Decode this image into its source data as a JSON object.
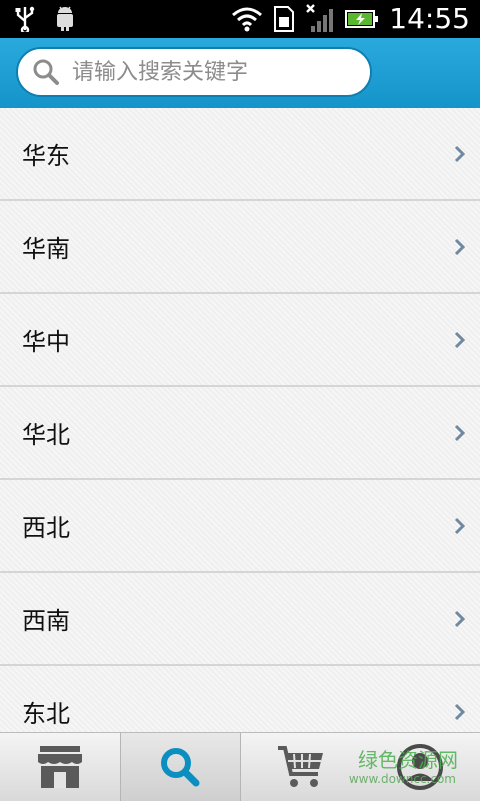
{
  "status_bar": {
    "time": "14:55",
    "icons": [
      "usb-icon",
      "android-debug-icon",
      "wifi-icon",
      "sim-icon",
      "signal-icon",
      "battery-charging-icon"
    ]
  },
  "search": {
    "placeholder": "请输入搜索关键字",
    "value": ""
  },
  "regions": [
    {
      "label": "华东"
    },
    {
      "label": "华南"
    },
    {
      "label": "华中"
    },
    {
      "label": "华北"
    },
    {
      "label": "西北"
    },
    {
      "label": "西南"
    },
    {
      "label": "东北"
    }
  ],
  "tabs": [
    {
      "name": "store-tab",
      "icon": "store-icon",
      "active": false
    },
    {
      "name": "search-tab",
      "icon": "search-icon",
      "active": true
    },
    {
      "name": "cart-tab",
      "icon": "cart-icon",
      "active": false
    },
    {
      "name": "profile-tab",
      "icon": "user-icon",
      "active": false
    }
  ],
  "watermark": {
    "text": "绿色资源网",
    "sub": "www.downcc.com"
  },
  "colors": {
    "header": "#1a9fd6",
    "active_tab_icon": "#0a8fc0"
  }
}
